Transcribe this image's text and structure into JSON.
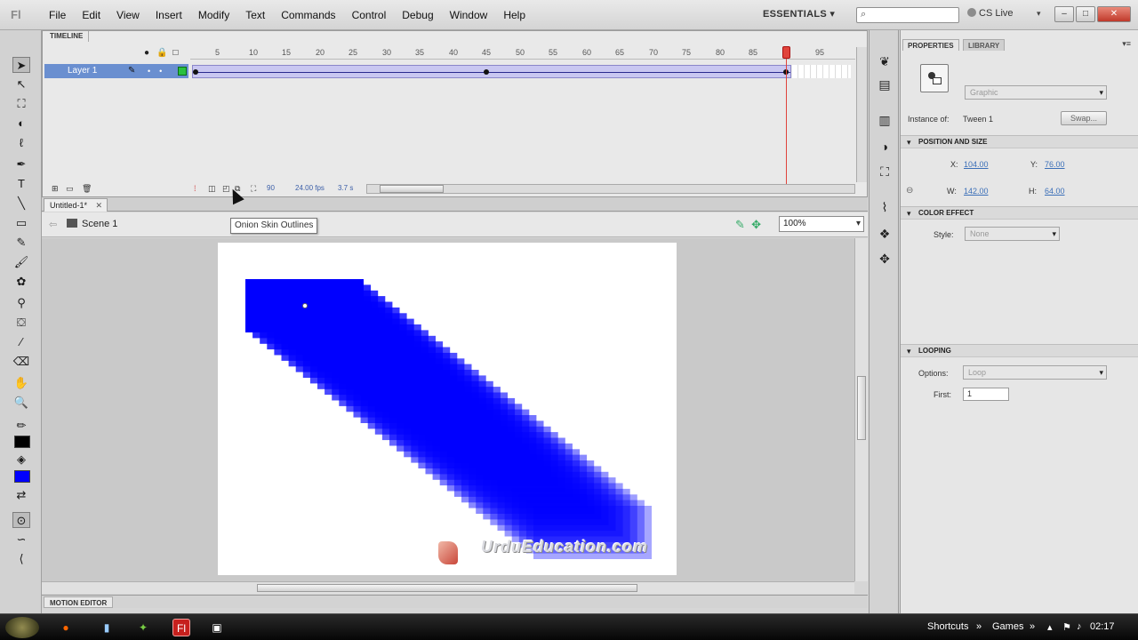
{
  "menubar": {
    "logo": "Fl",
    "items": [
      "File",
      "Edit",
      "View",
      "Insert",
      "Modify",
      "Text",
      "Commands",
      "Control",
      "Debug",
      "Window",
      "Help"
    ],
    "workspace": "ESSENTIALS",
    "search_icon": "search-icon",
    "cs_live": "CS Live",
    "minimize": "–",
    "maximize": "□",
    "close": "✕"
  },
  "timeline": {
    "tab": "TIMELINE",
    "ruler_ticks": [
      "5",
      "10",
      "15",
      "20",
      "25",
      "30",
      "35",
      "40",
      "45",
      "50",
      "55",
      "60",
      "65",
      "70",
      "75",
      "80",
      "85",
      "95"
    ],
    "playhead_frame": "90",
    "layer_name": "Layer 1",
    "current_frame": "90",
    "frame_rate": "24.00 fps",
    "elapsed_time": "3.7 s"
  },
  "tooltip": "Onion Skin Outlines",
  "document": {
    "tab": "Untitled-1*",
    "scene": "Scene 1",
    "zoom": "100%"
  },
  "stage": {
    "shape_color": "#0000ff",
    "watermark": "UrduEducation.com"
  },
  "motion_editor": {
    "tab": "MOTION EDITOR"
  },
  "properties": {
    "tab_properties": "PROPERTIES",
    "tab_library": "LIBRARY",
    "symbol_type": "Graphic",
    "instance_of_label": "Instance of:",
    "instance_of_value": "Tween 1",
    "swap_button": "Swap...",
    "position_section": "POSITION AND SIZE",
    "x_label": "X:",
    "x_value": "104.00",
    "y_label": "Y:",
    "y_value": "76.00",
    "w_label": "W:",
    "w_value": "142.00",
    "h_label": "H:",
    "h_value": "64.00",
    "color_section": "COLOR EFFECT",
    "style_label": "Style:",
    "style_value": "None",
    "looping_section": "LOOPING",
    "options_label": "Options:",
    "options_value": "Loop",
    "first_label": "First:",
    "first_value": "1"
  },
  "taskbar": {
    "shortcuts": "Shortcuts",
    "games": "Games",
    "clock": "02:17"
  }
}
